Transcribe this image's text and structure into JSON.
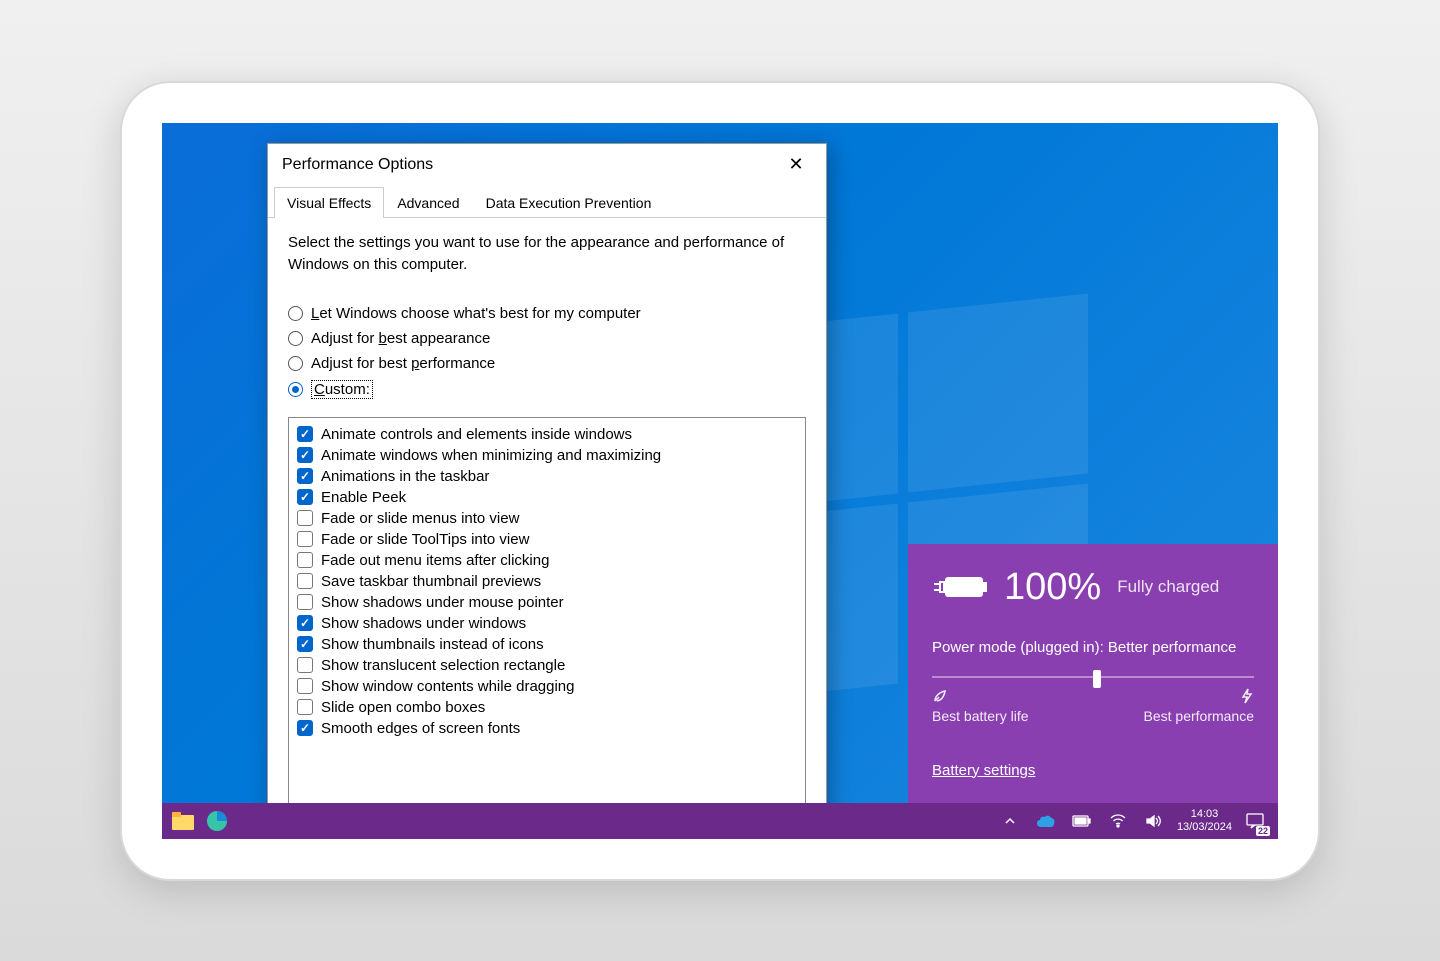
{
  "dialog": {
    "title": "Performance Options",
    "tabs": [
      "Visual Effects",
      "Advanced",
      "Data Execution Prevention"
    ],
    "active_tab": 0,
    "instruction": "Select the settings you want to use for the appearance and performance of Windows on this computer.",
    "radios": [
      {
        "label": "Let Windows choose what's best for my computer",
        "checked": false,
        "key": "L"
      },
      {
        "label": "Adjust for best appearance",
        "checked": false,
        "key": "b"
      },
      {
        "label": "Adjust for best performance",
        "checked": false,
        "key": "p"
      },
      {
        "label": "Custom:",
        "checked": true,
        "key": "C",
        "focused": true
      }
    ],
    "options": [
      {
        "label": "Animate controls and elements inside windows",
        "checked": true
      },
      {
        "label": "Animate windows when minimizing and maximizing",
        "checked": true
      },
      {
        "label": "Animations in the taskbar",
        "checked": true
      },
      {
        "label": "Enable Peek",
        "checked": true
      },
      {
        "label": "Fade or slide menus into view",
        "checked": false
      },
      {
        "label": "Fade or slide ToolTips into view",
        "checked": false
      },
      {
        "label": "Fade out menu items after clicking",
        "checked": false
      },
      {
        "label": "Save taskbar thumbnail previews",
        "checked": false
      },
      {
        "label": "Show shadows under mouse pointer",
        "checked": false
      },
      {
        "label": "Show shadows under windows",
        "checked": true
      },
      {
        "label": "Show thumbnails instead of icons",
        "checked": true
      },
      {
        "label": "Show translucent selection rectangle",
        "checked": false
      },
      {
        "label": "Show window contents while dragging",
        "checked": false
      },
      {
        "label": "Slide open combo boxes",
        "checked": false
      },
      {
        "label": "Smooth edges of screen fonts",
        "checked": true
      }
    ]
  },
  "battery": {
    "percent": "100%",
    "status": "Fully charged",
    "mode_label": "Power mode (plugged in): Better performance",
    "slider_left_label": "Best battery life",
    "slider_right_label": "Best performance",
    "settings_link": "Battery settings"
  },
  "taskbar": {
    "time": "14:03",
    "date": "13/03/2024",
    "notification_count": "22"
  }
}
